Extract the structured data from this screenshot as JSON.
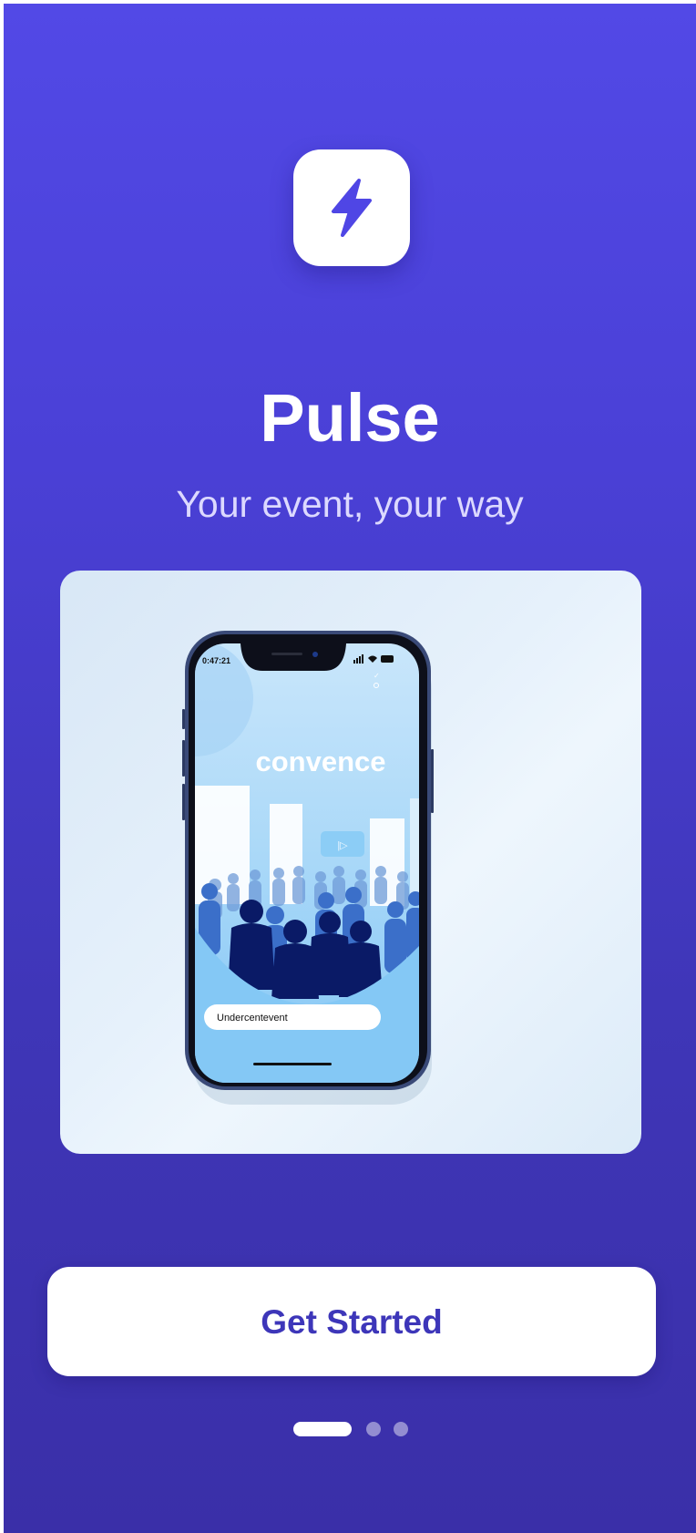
{
  "app": {
    "logo_icon": "lightning-bolt-icon",
    "title": "Pulse",
    "subtitle": "Your event, your way"
  },
  "hero": {
    "phone_mockup": {
      "status_time": "0:47:21",
      "headline": "convence",
      "search_text": "Undercentevent",
      "play_icon": "play-icon"
    }
  },
  "cta": {
    "label": "Get Started"
  },
  "pagination": {
    "total": 3,
    "active_index": 0
  },
  "colors": {
    "gradient_top": "#5249e6",
    "gradient_bottom": "#3a2fa8",
    "accent": "#3d36b9",
    "white": "#ffffff"
  }
}
